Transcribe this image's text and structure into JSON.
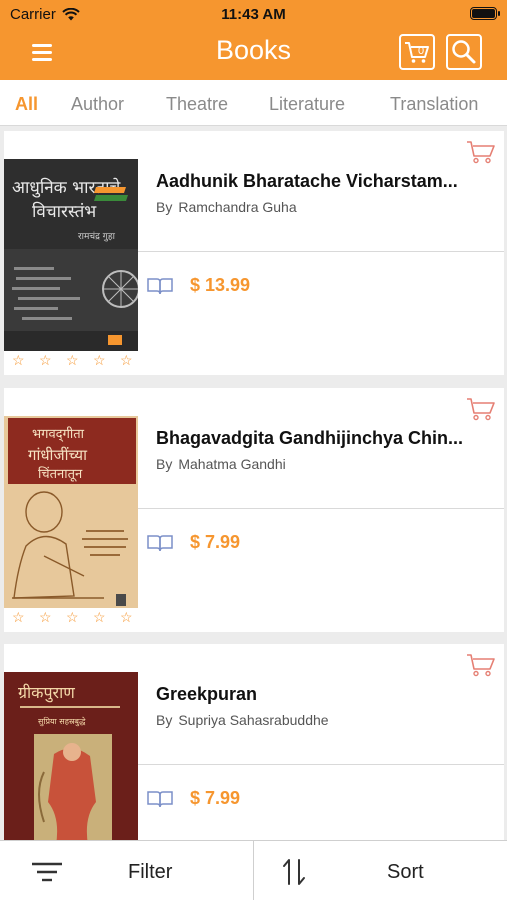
{
  "status_bar": {
    "carrier": "Carrier",
    "time": "11:43 AM"
  },
  "header": {
    "title": "Books",
    "cart_count": "0",
    "menu_icon": "hamburger-icon",
    "cart_icon": "cart-icon",
    "search_icon": "search-icon"
  },
  "tabs": [
    {
      "label": "All",
      "active": true
    },
    {
      "label": "Author"
    },
    {
      "label": "Theatre"
    },
    {
      "label": "Literature"
    },
    {
      "label": "Translation"
    }
  ],
  "books": [
    {
      "title": "Aadhunik Bharatache Vicharstam...",
      "by": "By",
      "author": "Ramchandra Guha",
      "price": "$ 13.99",
      "rating": 0,
      "cover_text_1": "आधुनिक भारताचे",
      "cover_text_2": "विचारस्तंभ",
      "cover_text_3": "रामचंद्र गुहा"
    },
    {
      "title": "Bhagavadgita Gandhijinchya Chin...",
      "by": "By",
      "author": "Mahatma Gandhi",
      "price": "$ 7.99",
      "rating": 0,
      "cover_text_1": "भगवद्‌गीता",
      "cover_text_2": "गांधीजींच्या",
      "cover_text_3": "चिंतनातून"
    },
    {
      "title": "Greekpuran",
      "by": "By",
      "author": "Supriya Sahasrabuddhe",
      "price": "$ 7.99",
      "rating": 0,
      "cover_text_1": "ग्रीकपुराण",
      "cover_text_2": "सुप्रिया सहस्रबुद्धे"
    }
  ],
  "bottom_bar": {
    "filter_label": "Filter",
    "sort_label": "Sort"
  },
  "colors": {
    "accent": "#f6962f",
    "background": "#ececec"
  }
}
